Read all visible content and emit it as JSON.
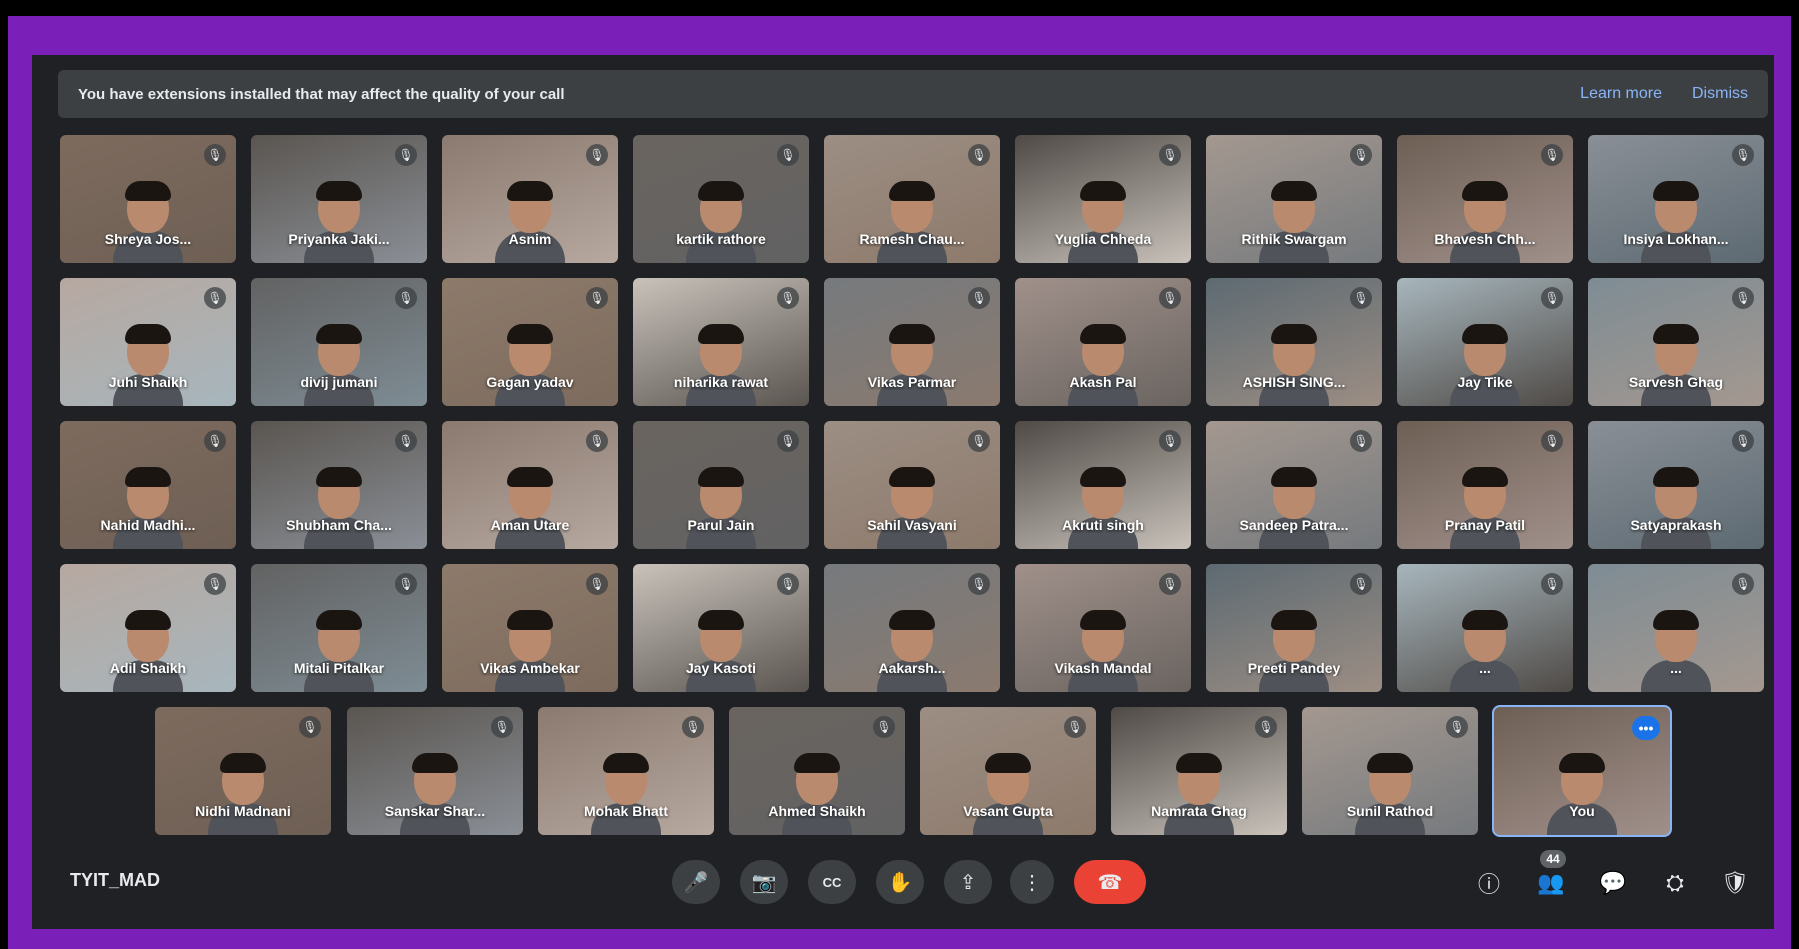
{
  "banner": {
    "message": "You have extensions installed that may affect the quality of your call",
    "learn_more": "Learn more",
    "dismiss": "Dismiss"
  },
  "participants": [
    "Shreya Jos...",
    "Priyanka Jaki...",
    "Asnim",
    "kartik rathore",
    "Ramesh Chau...",
    "Yuglia Chheda",
    "Rithik Swargam",
    "Bhavesh Chh...",
    "Insiya Lokhan...",
    "Juhi Shaikh",
    "divij jumani",
    "Gagan yadav",
    "niharika rawat",
    "Vikas Parmar",
    "Akash Pal",
    "ASHISH SING...",
    "Jay Tike",
    "Sarvesh Ghag",
    "Nahid Madhi...",
    "Shubham Cha...",
    "Aman Utare",
    "Parul Jain",
    "Sahil Vasyani",
    "Akruti singh",
    "Sandeep Patra...",
    "Pranay Patil",
    "Satyaprakash",
    "Adil Shaikh",
    "Mitali Pitalkar",
    "Vikas Ambekar",
    "Jay Kasoti",
    "Aakarsh...",
    "Vikash Mandal",
    "Preeti Pandey",
    "...",
    "...",
    "Nidhi Madnani",
    "Sanskar Shar...",
    "Mohak Bhatt",
    "Ahmed Shaikh",
    "Vasant Gupta",
    "Namrata Ghag",
    "Sunil Rathod",
    "You"
  ],
  "meeting_code": "TYIT_MAD",
  "participant_count": "44",
  "icons": {
    "mic": "🎤",
    "camera": "📷",
    "captions": "CC",
    "hand": "✋",
    "present": "⇪",
    "more": "⋮",
    "end_call": "☎",
    "info": "ⓘ",
    "people": "👥",
    "chat": "💬",
    "activities": "⛭",
    "host": "🛡",
    "muted_mic": "🎙",
    "tile_more": "•••"
  }
}
